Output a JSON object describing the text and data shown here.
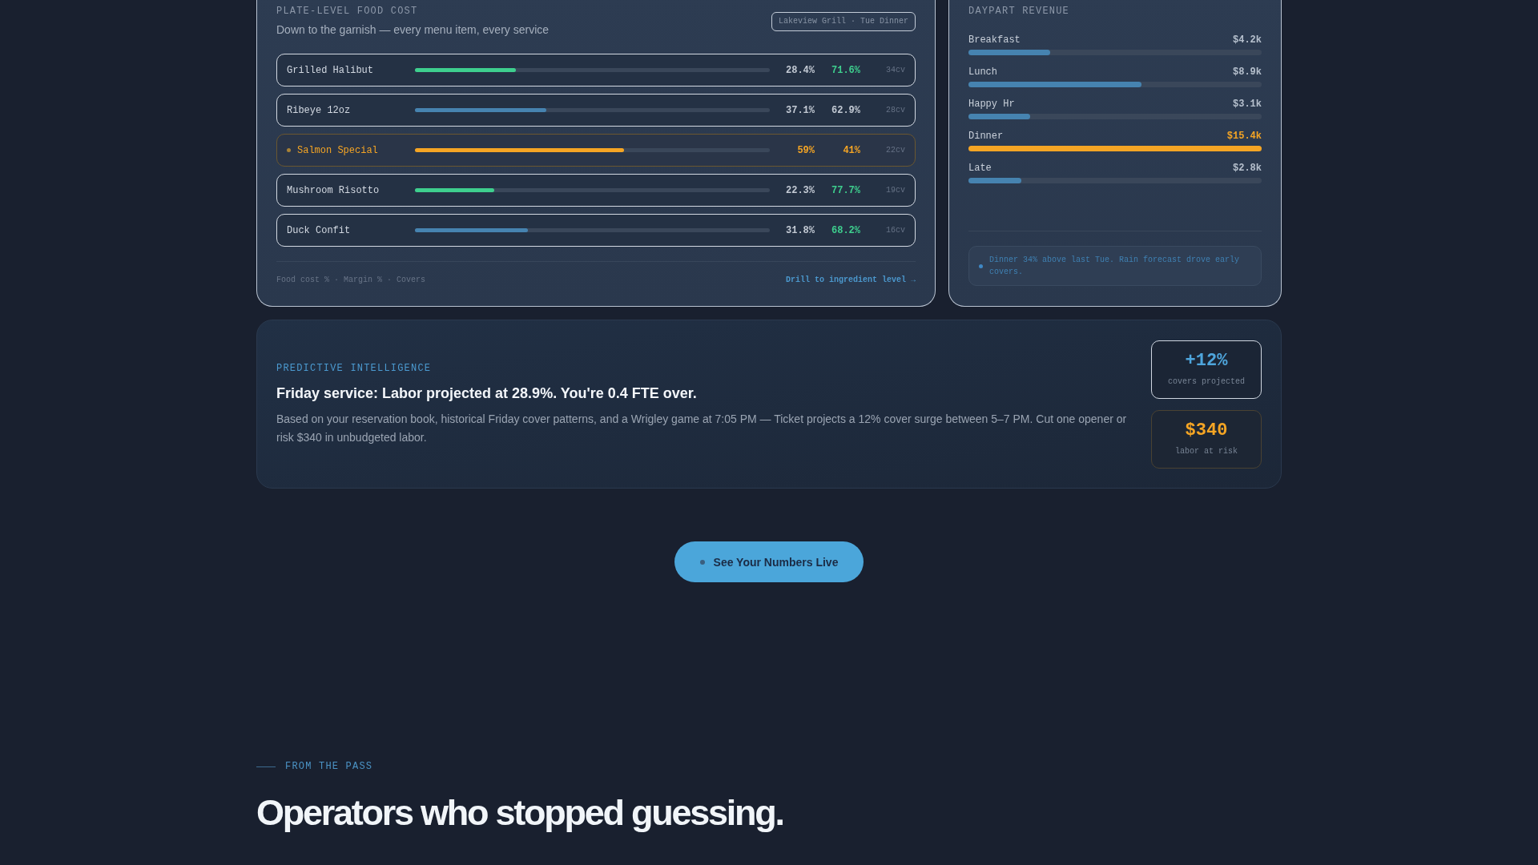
{
  "food_cost": {
    "title": "PLATE-LEVEL FOOD COST",
    "subtitle": "Down to the garnish — every menu item, every service",
    "badge": "Lakeview Grill · Tue Dinner",
    "rows": [
      {
        "name": "Grilled Halibut",
        "level": 0.284,
        "color": "#3ecf8e",
        "food_cost": "28.4%",
        "margin": {
          "value": "71.6%",
          "color": "#3ecf8e"
        },
        "covers": "34cv",
        "flagged": false
      },
      {
        "name": "Ribeye 12oz",
        "level": 0.371,
        "color": "#4683b0",
        "food_cost": "37.1%",
        "margin": {
          "value": "62.9%",
          "color": "#c3cad4"
        },
        "covers": "28cv",
        "flagged": false
      },
      {
        "name": "Salmon Special",
        "level": 0.59,
        "color": "#f5a524",
        "food_cost": "59%",
        "margin": {
          "value": "41%",
          "color": "#f5a524"
        },
        "covers": "22cv",
        "flagged": true
      },
      {
        "name": "Mushroom Risotto",
        "level": 0.223,
        "color": "#3ecf8e",
        "food_cost": "22.3%",
        "margin": {
          "value": "77.7%",
          "color": "#3ecf8e"
        },
        "covers": "19cv",
        "flagged": false
      },
      {
        "name": "Duck Confit",
        "level": 0.318,
        "color": "#4683b0",
        "food_cost": "31.8%",
        "margin": {
          "value": "68.2%",
          "color": "#3ecf8e"
        },
        "covers": "16cv",
        "flagged": false
      }
    ],
    "legend": "Food cost % · Margin % · Covers",
    "link": "Drill to ingredient level →"
  },
  "daypart_revenue": {
    "title": "DAYPART REVENUE",
    "items": [
      {
        "label": "Breakfast",
        "value": "$4.2k",
        "level": 0.28,
        "highlighted": false
      },
      {
        "label": "Lunch",
        "value": "$8.9k",
        "level": 0.59,
        "highlighted": false
      },
      {
        "label": "Happy Hr",
        "value": "$3.1k",
        "level": 0.21,
        "highlighted": false
      },
      {
        "label": "Dinner",
        "value": "$15.4k",
        "level": 1,
        "highlighted": true
      },
      {
        "label": "Late",
        "value": "$2.8k",
        "level": 0.18,
        "highlighted": false
      }
    ],
    "note": "Dinner 34% above last Tue. Rain forecast drove early covers."
  },
  "prediction": {
    "eyebrow": "PREDICTIVE INTELLIGENCE",
    "headline": "Friday service: Labor projected at 28.9%. You're 0.4 FTE over.",
    "body": "Based on your reservation book, historical Friday cover patterns, and a Wrigley game at 7:05 PM — Ticket projects a 12% cover surge between 5–7 PM. Cut one opener or risk $340 in unbudgeted labor.",
    "stats": [
      {
        "kind": "positive",
        "value": "+12%",
        "label": "covers projected"
      },
      {
        "kind": "risk",
        "value": "$340",
        "label": "labor at risk"
      }
    ]
  },
  "cta": {
    "label": "See Your Numbers Live"
  },
  "testimonials": {
    "eyebrow": "FROM THE PASS",
    "heading": "Operators who stopped guessing."
  }
}
